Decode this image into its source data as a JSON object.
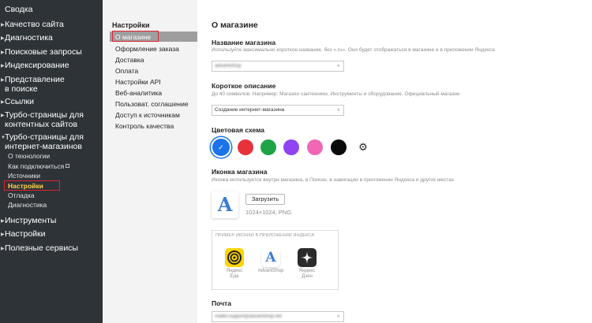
{
  "sidebar": {
    "items": [
      {
        "label": "Сводка",
        "arrow": false
      },
      {
        "label": "Качество сайта",
        "arrow": true
      },
      {
        "label": "Диагностика",
        "arrow": true
      },
      {
        "label": "Поисковые запросы",
        "arrow": true
      },
      {
        "label": "Индексирование",
        "arrow": true
      },
      {
        "label": "Представление",
        "label2": "в поиске",
        "arrow": true
      },
      {
        "label": "Ссылки",
        "arrow": true
      },
      {
        "label": "Турбо-страницы для",
        "label2": "контентных сайтов",
        "arrow": true
      },
      {
        "label": "Турбо-страницы для",
        "label2": "интернет-магазинов",
        "arrow": true,
        "open": true
      },
      {
        "label": "Инструменты",
        "arrow": true
      },
      {
        "label": "Настройки",
        "arrow": true
      },
      {
        "label": "Полезные сервисы",
        "arrow": true
      }
    ],
    "subitems": [
      {
        "label": "О технологии"
      },
      {
        "label": "Как подключиться",
        "external": true
      },
      {
        "label": "Источники"
      },
      {
        "label": "Настройки",
        "active": true
      },
      {
        "label": "Отладка"
      },
      {
        "label": "Диагностика"
      }
    ]
  },
  "settings_menu": {
    "title": "Настройки",
    "items": [
      {
        "label": "О магазине",
        "active": true
      },
      {
        "label": "Оформление заказа"
      },
      {
        "label": "Доставка"
      },
      {
        "label": "Оплата"
      },
      {
        "label": "Настройки API"
      },
      {
        "label": "Веб-аналитика"
      },
      {
        "label": "Пользоват. соглашение"
      },
      {
        "label": "Доступ к источникам"
      },
      {
        "label": "Контроль качества"
      }
    ]
  },
  "main": {
    "title": "О магазине",
    "store_name": {
      "label": "Название магазина",
      "hint": "Используйте максимально короткое название, без «.ru». Оно будет отображаться в магазине и в приложении Яндекса",
      "value": "advantshop",
      "clear": "×"
    },
    "short_description": {
      "label": "Короткое описание",
      "hint": "До 40 символов. Например: Магазин сантехники, Инструменты и оборудование, Официальный магазин",
      "value": "Создание интернет-магазина",
      "clear": "×"
    },
    "color_scheme": {
      "label": "Цветовая схема",
      "check": "✓",
      "colors": [
        "#1a73e8",
        "#e8323b",
        "#1ea446",
        "#8e44f0",
        "#f067b4",
        "#0a0a0a"
      ],
      "selected_index": 0,
      "gear_icon": "gear-icon"
    },
    "store_icon": {
      "label": "Иконка магазина",
      "hint": "Иконка используется внутри магазина, в Поиске, в навигации в приложении Яндекса и других местах",
      "logo_letter": "A",
      "upload_label": "Загрузить",
      "size_note": "1024×1024, PNG"
    },
    "preview": {
      "title": "ПРИМЕР ИКОНКИ В ПРИЛОЖЕНИИ ЯНДЕКСА",
      "icons": [
        {
          "label1": "Яндекс",
          "label2": "Еда",
          "bg": "#ffd500"
        },
        {
          "label1": "AdvantShop",
          "label2": "",
          "bg": "#ffffff"
        },
        {
          "label1": "Яндекс",
          "label2": "Дзен",
          "bg": "#2b2b2b"
        }
      ]
    },
    "email": {
      "label": "Почта",
      "value": "mailto:support@advantshop.net",
      "clear": "×"
    }
  }
}
